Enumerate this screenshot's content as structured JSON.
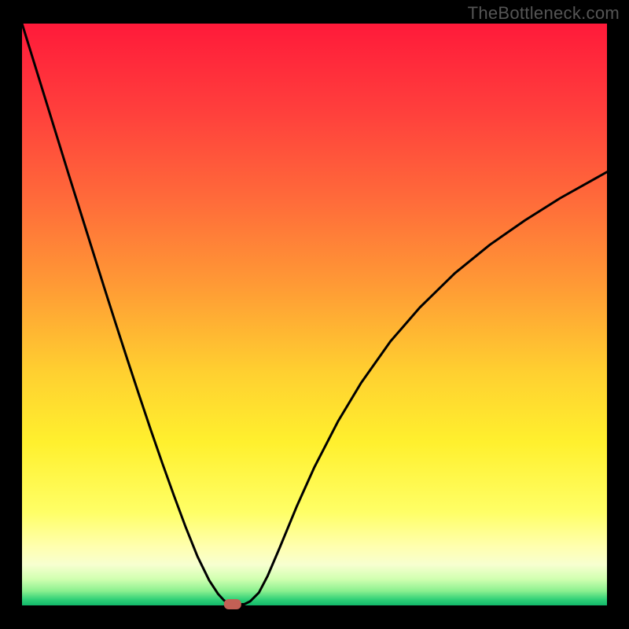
{
  "watermark": "TheBottleneck.com",
  "chart_data": {
    "type": "line",
    "title": "",
    "xlabel": "",
    "ylabel": "",
    "xlim": [
      0,
      100
    ],
    "ylim": [
      0,
      100
    ],
    "grid": false,
    "legend": false,
    "background_gradient": {
      "stops": [
        {
          "offset": 0.0,
          "color": "#ff1a3a"
        },
        {
          "offset": 0.15,
          "color": "#ff3f3c"
        },
        {
          "offset": 0.3,
          "color": "#ff6a3a"
        },
        {
          "offset": 0.45,
          "color": "#ff9a35"
        },
        {
          "offset": 0.6,
          "color": "#ffd030"
        },
        {
          "offset": 0.72,
          "color": "#fff02e"
        },
        {
          "offset": 0.84,
          "color": "#ffff66"
        },
        {
          "offset": 0.9,
          "color": "#ffffb0"
        },
        {
          "offset": 0.93,
          "color": "#f7ffd0"
        },
        {
          "offset": 0.955,
          "color": "#d0ffb0"
        },
        {
          "offset": 0.975,
          "color": "#8cf090"
        },
        {
          "offset": 0.99,
          "color": "#30d077"
        },
        {
          "offset": 1.0,
          "color": "#12b86a"
        }
      ]
    },
    "series": [
      {
        "name": "bottleneck-curve",
        "stroke": "#000000",
        "x": [
          0.0,
          2.0,
          4.0,
          6.0,
          8.0,
          10.0,
          12.0,
          14.0,
          16.0,
          18.0,
          20.0,
          22.0,
          24.0,
          26.0,
          28.0,
          30.0,
          32.0,
          33.5,
          34.5,
          35.5,
          36.5,
          37.0,
          38.0,
          39.0,
          40.5,
          42.0,
          44.0,
          47.0,
          50.0,
          54.0,
          58.0,
          63.0,
          68.0,
          74.0,
          80.0,
          86.0,
          92.0,
          100.0
        ],
        "y": [
          100.0,
          93.5,
          87.0,
          80.5,
          74.0,
          67.6,
          61.2,
          54.8,
          48.5,
          42.3,
          36.2,
          30.2,
          24.4,
          18.8,
          13.4,
          8.4,
          4.3,
          2.0,
          0.9,
          0.2,
          0.2,
          0.2,
          0.2,
          0.7,
          2.2,
          5.1,
          9.8,
          17.1,
          23.8,
          31.6,
          38.3,
          45.4,
          51.2,
          57.1,
          62.0,
          66.2,
          70.0,
          74.5
        ]
      }
    ],
    "marker": {
      "name": "optimal-point",
      "x": 36.0,
      "y": 0.2,
      "color": "#c26055"
    },
    "annotations": []
  }
}
